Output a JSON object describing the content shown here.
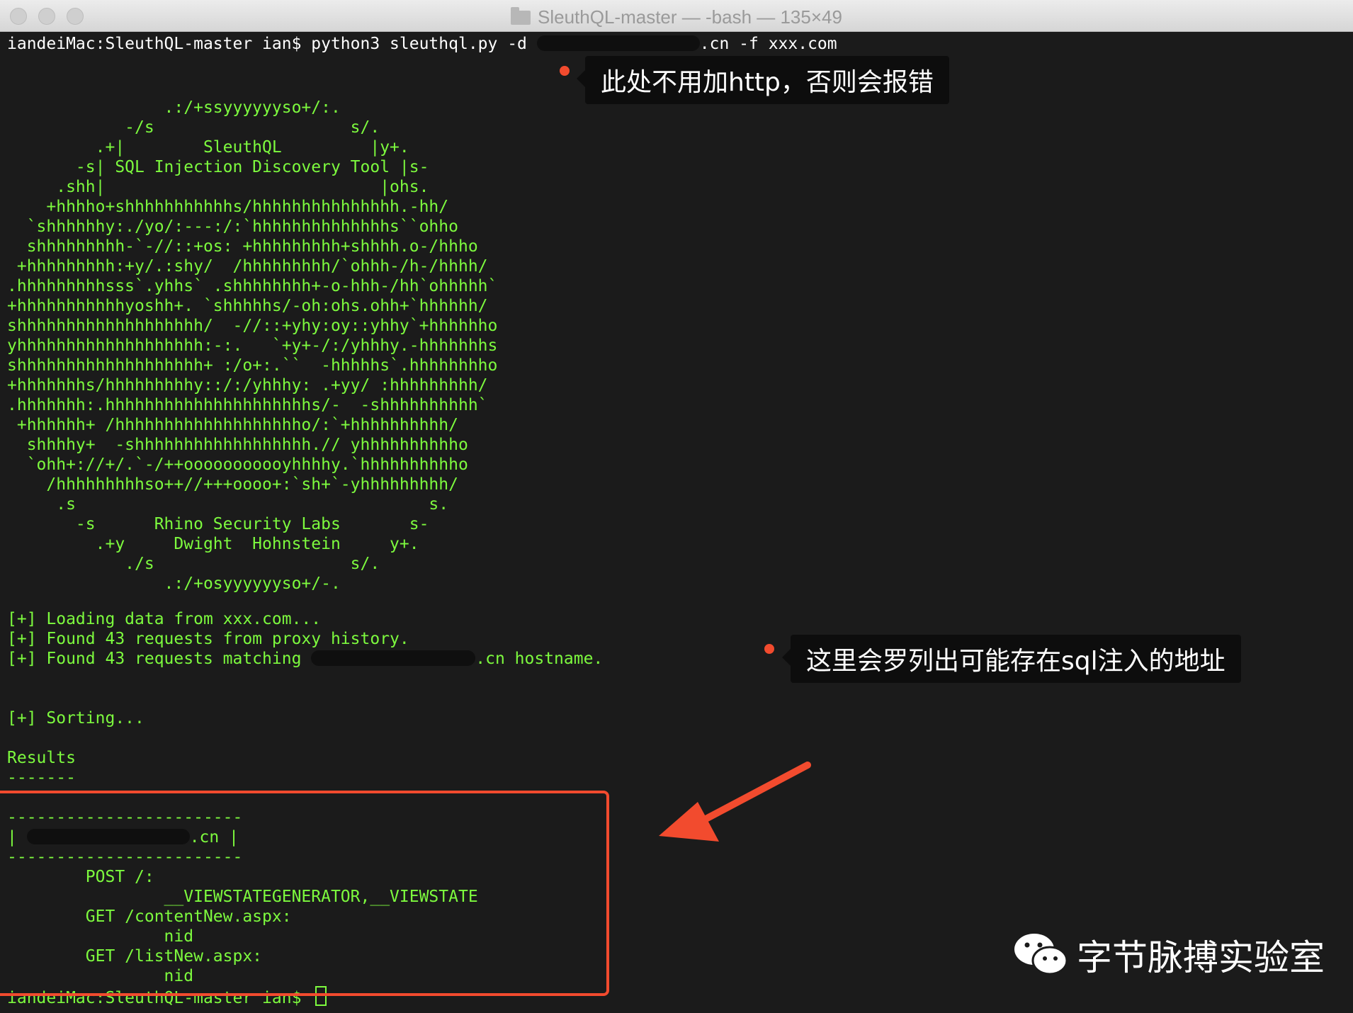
{
  "window": {
    "title": "SleuthQL-master — -bash — 135×49"
  },
  "terminal": {
    "command_prompt": "iandeiMac:SleuthQL-master ian$ ",
    "command_text": "python3 sleuthql.py -d ",
    "command_args": ".cn -f xxx.com",
    "banner": [
      "                .:/+ssyyyyyyso+/:.",
      "            -/s                    s/.",
      "         .+|        SleuthQL         |y+.",
      "       -s| SQL Injection Discovery Tool |s-",
      "     .shh|                            |ohs.",
      "    +hhhho+shhhhhhhhhhhs/hhhhhhhhhhhhhhh.-hh/",
      "  `shhhhhhy:./yo/:---:/:`hhhhhhhhhhhhhhs``ohho",
      "  shhhhhhhhh-`-//::+os: +hhhhhhhhh+shhhh.o-/hhho",
      " +hhhhhhhhh:+y/.:shy/  /hhhhhhhhh/`ohhh-/h-/hhhh/",
      ".hhhhhhhhhsss`.yhhs` .shhhhhhhh+-o-hhh-/hh`ohhhhh`",
      "+hhhhhhhhhhhyoshh+. `shhhhhs/-oh:ohs.ohh+`hhhhhh/",
      "shhhhhhhhhhhhhhhhhhh/  -//::+yhy:oy::yhhy`+hhhhhho",
      "yhhhhhhhhhhhhhhhhhhh:-:.   `+y+-/:/yhhhy.-hhhhhhhs",
      "shhhhhhhhhhhhhhhhhhh+ :/o+:.``  -hhhhhs`.hhhhhhhho",
      "+hhhhhhhs/hhhhhhhhhy::/:/yhhhy: .+yy/ :hhhhhhhhh/",
      ".hhhhhhh:.hhhhhhhhhhhhhhhhhhhhhs/-  -shhhhhhhhhh`",
      " +hhhhhh+ /hhhhhhhhhhhhhhhhhhho/:`+hhhhhhhhhh/",
      "  shhhhy+  -shhhhhhhhhhhhhhhhhh.// yhhhhhhhhhho",
      "  `ohh+://+/.`-/++ooooooooooyhhhhy.`hhhhhhhhhho",
      "    /hhhhhhhhhso++//+++oooo+:`sh+`-yhhhhhhhhh/",
      "     .s                                    s.",
      "       -s      Rhino Security Labs       s-",
      "         .+y     Dwight  Hohnstein     y+.",
      "            ./s                    s/.",
      "                .:/+osyyyyyyso+/-."
    ],
    "log_loading": "[+] Loading data from xxx.com...",
    "log_found_proxy": "[+] Found 43 requests from proxy history.",
    "log_found_match_prefix": "[+] Found 43 requests matching ",
    "log_found_match_suffix": ".cn hostname.",
    "log_sorting": "[+] Sorting...",
    "results_header": "Results",
    "results_rule": "-------",
    "box_rule": "------------------------",
    "host_prefix": "| ",
    "host_suffix": ".cn |",
    "results": [
      "        POST /:",
      "                __VIEWSTATEGENERATOR,__VIEWSTATE",
      "        GET /contentNew.aspx:",
      "                nid",
      "        GET /listNew.aspx:",
      "                nid"
    ],
    "final_prompt": "iandeiMac:SleuthQL-master ian$ "
  },
  "annotations": {
    "callout_http": "此处不用加http，否则会报错",
    "callout_sql": "这里会罗列出可能存在sql注入的地址",
    "color_highlight": "#f24b2e"
  },
  "watermark": {
    "text": "字节脉搏实验室",
    "icon": "wechat-icon"
  }
}
